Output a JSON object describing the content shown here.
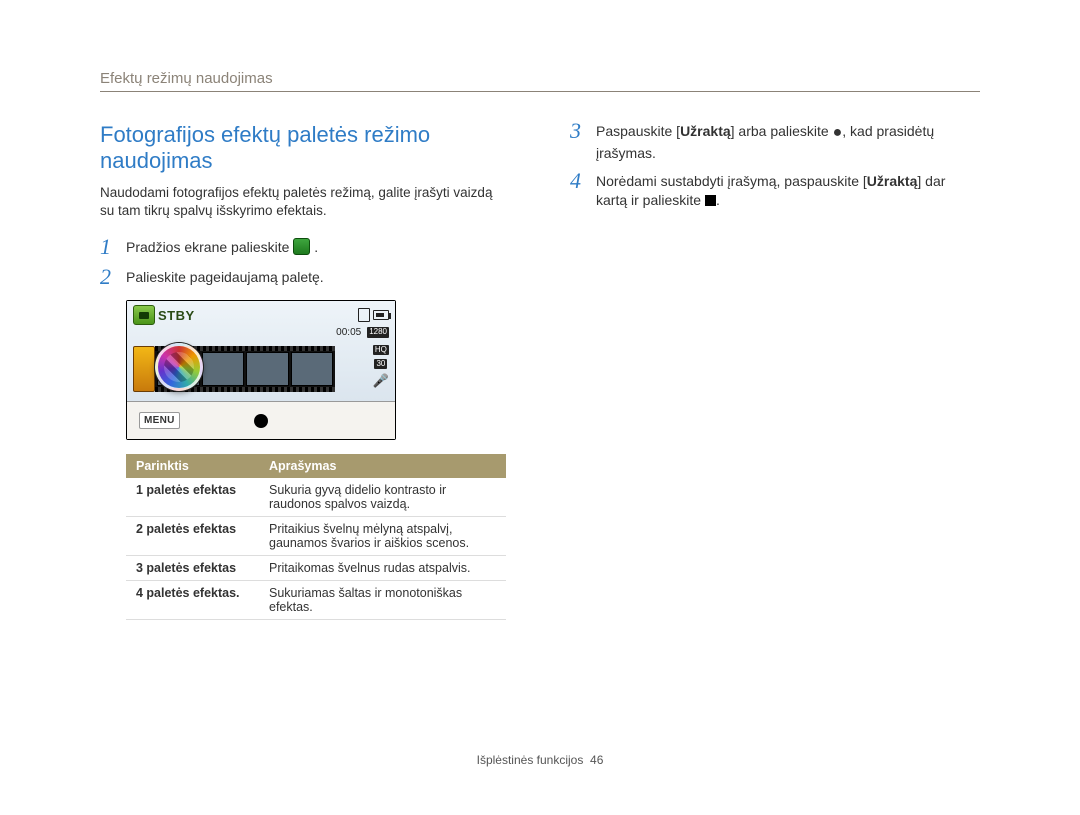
{
  "header": {
    "breadcrumb": "Efektų režimų naudojimas"
  },
  "left": {
    "title": "Fotografijos efektų paletės režimo naudojimas",
    "intro": "Naudodami fotografijos efektų paletės režimą, galite įrašyti vaizdą su tam tikrų spalvų išskyrimo efektais.",
    "step1": "Pradžios ekrane palieskite ",
    "step1_end": ".",
    "step2": "Palieskite pageidaujamą paletę.",
    "cam": {
      "stby": "STBY",
      "time": "00:05",
      "res1": "1280",
      "res2": "HQ",
      "res3": "30",
      "menu": "MENU"
    },
    "table": {
      "head_option": "Parinktis",
      "head_desc": "Aprašymas",
      "rows": [
        {
          "opt": "1 paletės efektas",
          "desc": "Sukuria gyvą didelio kontrasto ir raudonos spalvos vaizdą."
        },
        {
          "opt": "2 paletės efektas",
          "desc": "Pritaikius švelnų mėlyną atspalvį, gaunamos švarios ir aiškios scenos."
        },
        {
          "opt": "3 paletės efektas",
          "desc": "Pritaikomas švelnus rudas atspalvis."
        },
        {
          "opt": "4 paletės efektas.",
          "desc": "Sukuriamas šaltas ir monotoniškas efektas."
        }
      ]
    }
  },
  "right": {
    "step3_a": "Paspauskite [",
    "step3_bold1": "Užraktą",
    "step3_b": "] arba palieskite ",
    "step3_c": ", kad prasidėtų įrašymas.",
    "step4_a": "Norėdami sustabdyti įrašymą, paspauskite [",
    "step4_bold1": "Užraktą",
    "step4_b": "] dar kartą ir palieskite ",
    "step4_c": "."
  },
  "footer": {
    "section": "Išplėstinės funkcijos",
    "page": "46"
  }
}
